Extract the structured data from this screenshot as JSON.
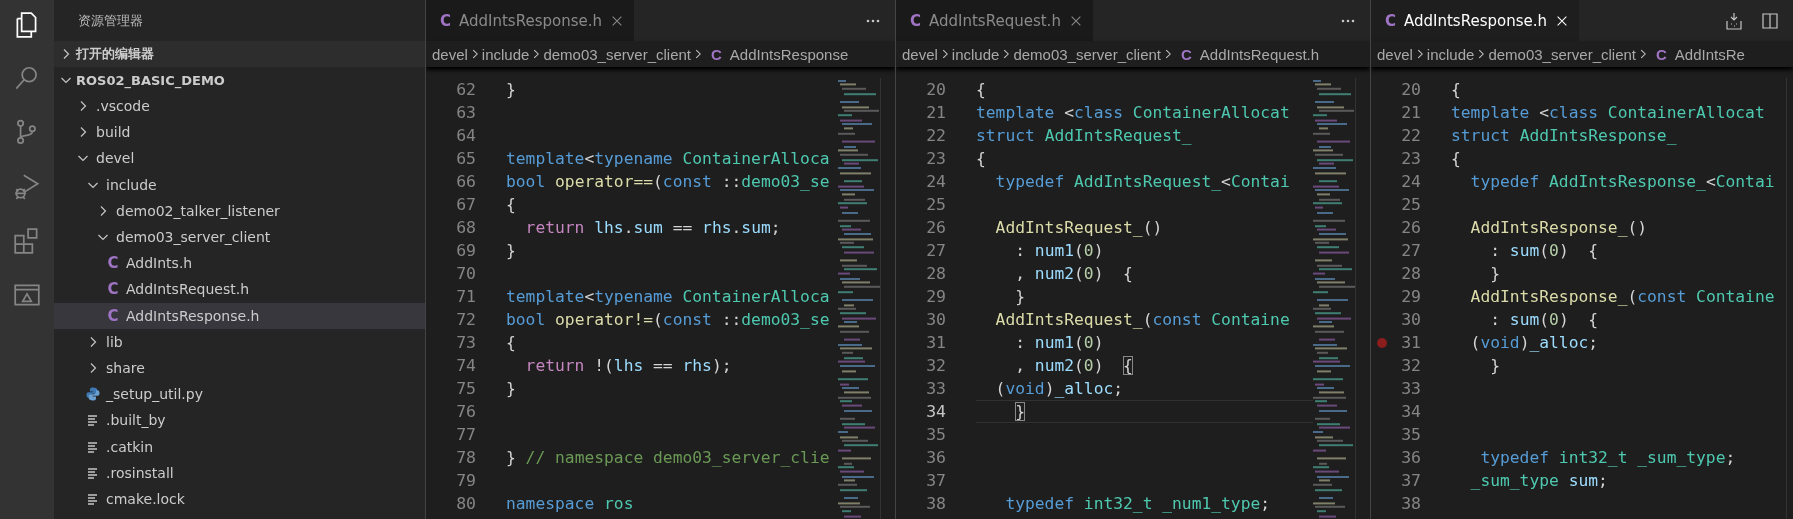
{
  "activity_bar": [
    {
      "kind": "files",
      "selected": true
    },
    {
      "kind": "search",
      "selected": false
    },
    {
      "kind": "source-control",
      "selected": false
    },
    {
      "kind": "run-debug",
      "selected": false
    },
    {
      "kind": "extensions",
      "selected": false
    },
    {
      "kind": "remote",
      "selected": false
    }
  ],
  "sidebar": {
    "title": "资源管理器",
    "sections": [
      {
        "label": "打开的编辑器",
        "expanded": false
      },
      {
        "label": "ROS02_BASIC_DEMO",
        "expanded": true,
        "items": [
          {
            "label": ".vscode",
            "kind": "folder",
            "expanded": false,
            "selected": false
          },
          {
            "label": "build",
            "kind": "folder",
            "expanded": false,
            "selected": false
          },
          {
            "label": "devel",
            "kind": "folder",
            "expanded": true,
            "selected": false,
            "children": [
              {
                "label": "include",
                "kind": "folder",
                "expanded": true,
                "selected": false,
                "children": [
                  {
                    "label": "demo02_talker_listener",
                    "kind": "folder",
                    "expanded": false,
                    "selected": false
                  },
                  {
                    "label": "demo03_server_client",
                    "kind": "folder",
                    "expanded": true,
                    "selected": false,
                    "children": [
                      {
                        "label": "AddInts.h",
                        "kind": "c",
                        "icon": "C",
                        "selected": false
                      },
                      {
                        "label": "AddIntsRequest.h",
                        "kind": "c",
                        "icon": "C",
                        "selected": false
                      },
                      {
                        "label": "AddIntsResponse.h",
                        "kind": "c",
                        "icon": "C",
                        "selected": true
                      }
                    ]
                  }
                ]
              },
              {
                "label": "lib",
                "kind": "folder",
                "expanded": false,
                "selected": false
              },
              {
                "label": "share",
                "kind": "folder",
                "expanded": false,
                "selected": false
              },
              {
                "label": "_setup_util.py",
                "kind": "python",
                "selected": false
              },
              {
                "label": ".built_by",
                "kind": "text",
                "selected": false
              },
              {
                "label": ".catkin",
                "kind": "text",
                "selected": false
              },
              {
                "label": ".rosinstall",
                "kind": "text",
                "selected": false
              },
              {
                "label": "cmake.lock",
                "kind": "text",
                "selected": false
              }
            ]
          }
        ]
      }
    ]
  },
  "editors": [
    {
      "tab": {
        "icon": "C",
        "label": "AddIntsResponse.h",
        "selected": false
      },
      "actions": [
        {
          "kind": "more"
        }
      ],
      "breadcrumb": [
        "devel",
        "include",
        "demo03_server_client"
      ],
      "breadcrumb_file": {
        "icon": "C",
        "label": "AddIntsResponse"
      },
      "minimap": true,
      "lines": [
        {
          "number": "62",
          "tokens": [
            {
              "kind": "plain",
              "text": "}"
            }
          ]
        },
        {
          "number": "63"
        },
        {
          "number": "64"
        },
        {
          "number": "65",
          "tokens": [
            {
              "kind": "kw",
              "text": "template"
            },
            {
              "kind": "plain",
              "text": "<"
            },
            {
              "kind": "kw",
              "text": "typename"
            },
            {
              "kind": "type",
              "text": " ContainerAlloca"
            }
          ]
        },
        {
          "number": "66",
          "tokens": [
            {
              "kind": "kw",
              "text": "bool"
            },
            {
              "kind": "fn",
              "text": " operator=="
            },
            {
              "kind": "plain",
              "text": "("
            },
            {
              "kind": "kw",
              "text": "const"
            },
            {
              "kind": "plain",
              "text": " ::"
            },
            {
              "kind": "type",
              "text": "demo03_se"
            }
          ]
        },
        {
          "number": "67",
          "tokens": [
            {
              "kind": "plain",
              "text": "{"
            }
          ]
        },
        {
          "number": "68",
          "tokens": [
            {
              "kind": "ctrl",
              "text": "  return"
            },
            {
              "kind": "var",
              "text": " lhs"
            },
            {
              "kind": "plain",
              "text": "."
            },
            {
              "kind": "var",
              "text": "sum"
            },
            {
              "kind": "plain",
              "text": " == "
            },
            {
              "kind": "var",
              "text": "rhs"
            },
            {
              "kind": "plain",
              "text": "."
            },
            {
              "kind": "var",
              "text": "sum"
            },
            {
              "kind": "plain",
              "text": ";"
            }
          ]
        },
        {
          "number": "69",
          "tokens": [
            {
              "kind": "plain",
              "text": "}"
            }
          ]
        },
        {
          "number": "70"
        },
        {
          "number": "71",
          "tokens": [
            {
              "kind": "kw",
              "text": "template"
            },
            {
              "kind": "plain",
              "text": "<"
            },
            {
              "kind": "kw",
              "text": "typename"
            },
            {
              "kind": "type",
              "text": " ContainerAlloca"
            }
          ]
        },
        {
          "number": "72",
          "tokens": [
            {
              "kind": "kw",
              "text": "bool"
            },
            {
              "kind": "fn",
              "text": " operator!="
            },
            {
              "kind": "plain",
              "text": "("
            },
            {
              "kind": "kw",
              "text": "const"
            },
            {
              "kind": "plain",
              "text": " ::"
            },
            {
              "kind": "type",
              "text": "demo03_se"
            }
          ]
        },
        {
          "number": "73",
          "tokens": [
            {
              "kind": "plain",
              "text": "{"
            }
          ]
        },
        {
          "number": "74",
          "tokens": [
            {
              "kind": "ctrl",
              "text": "  return"
            },
            {
              "kind": "plain",
              "text": " !("
            },
            {
              "kind": "var",
              "text": "lhs"
            },
            {
              "kind": "plain",
              "text": " == "
            },
            {
              "kind": "var",
              "text": "rhs"
            },
            {
              "kind": "plain",
              "text": ");"
            }
          ]
        },
        {
          "number": "75",
          "tokens": [
            {
              "kind": "plain",
              "text": "}"
            }
          ]
        },
        {
          "number": "76"
        },
        {
          "number": "77"
        },
        {
          "number": "78",
          "tokens": [
            {
              "kind": "plain",
              "text": "}"
            },
            {
              "kind": "cm",
              "text": " // namespace demo03_server_clie"
            }
          ]
        },
        {
          "number": "79"
        },
        {
          "number": "80",
          "tokens": [
            {
              "kind": "kw",
              "text": "namespace"
            },
            {
              "kind": "type",
              "text": " ros"
            }
          ]
        }
      ]
    },
    {
      "tab": {
        "icon": "C",
        "label": "AddIntsRequest.h",
        "selected": false
      },
      "actions": [
        {
          "kind": "more"
        }
      ],
      "breadcrumb": [
        "devel",
        "include",
        "demo03_server_client"
      ],
      "breadcrumb_file": {
        "icon": "C",
        "label": "AddIntsRequest.h"
      },
      "minimap": true,
      "lines": [
        {
          "number": "20",
          "current": false,
          "tokens": [
            {
              "kind": "plain",
              "text": "{"
            }
          ]
        },
        {
          "number": "21",
          "current": false,
          "tokens": [
            {
              "kind": "kw",
              "text": "template"
            },
            {
              "kind": "plain",
              "text": " <"
            },
            {
              "kind": "kw",
              "text": "class"
            },
            {
              "kind": "type",
              "text": " ContainerAllocat"
            }
          ]
        },
        {
          "number": "22",
          "current": false,
          "tokens": [
            {
              "kind": "kw",
              "text": "struct"
            },
            {
              "kind": "type",
              "text": " AddIntsRequest_"
            }
          ]
        },
        {
          "number": "23",
          "current": false,
          "tokens": [
            {
              "kind": "plain",
              "text": "{"
            }
          ]
        },
        {
          "number": "24",
          "current": false,
          "tokens": [
            {
              "kind": "kw",
              "text": "  typedef"
            },
            {
              "kind": "type",
              "text": " AddIntsRequest_"
            },
            {
              "kind": "plain",
              "text": "<"
            },
            {
              "kind": "type",
              "text": "Contai"
            }
          ]
        },
        {
          "number": "25",
          "current": false
        },
        {
          "number": "26",
          "current": false,
          "tokens": [
            {
              "kind": "fn",
              "text": "  AddIntsRequest_"
            },
            {
              "kind": "plain",
              "text": "()"
            }
          ]
        },
        {
          "number": "27",
          "current": false,
          "tokens": [
            {
              "kind": "plain",
              "text": "    : "
            },
            {
              "kind": "var",
              "text": "num1"
            },
            {
              "kind": "plain",
              "text": "("
            },
            {
              "kind": "num",
              "text": "0"
            },
            {
              "kind": "plain",
              "text": ")"
            }
          ]
        },
        {
          "number": "28",
          "current": false,
          "tokens": [
            {
              "kind": "plain",
              "text": "    , "
            },
            {
              "kind": "var",
              "text": "num2"
            },
            {
              "kind": "plain",
              "text": "("
            },
            {
              "kind": "num",
              "text": "0"
            },
            {
              "kind": "plain",
              "text": ")  {"
            }
          ]
        },
        {
          "number": "29",
          "current": false,
          "tokens": [
            {
              "kind": "plain",
              "text": "    }"
            }
          ]
        },
        {
          "number": "30",
          "current": false,
          "tokens": [
            {
              "kind": "fn",
              "text": "  AddIntsRequest_"
            },
            {
              "kind": "plain",
              "text": "("
            },
            {
              "kind": "kw",
              "text": "const"
            },
            {
              "kind": "type",
              "text": " Containe"
            }
          ]
        },
        {
          "number": "31",
          "current": false,
          "tokens": [
            {
              "kind": "plain",
              "text": "    : "
            },
            {
              "kind": "var",
              "text": "num1"
            },
            {
              "kind": "plain",
              "text": "("
            },
            {
              "kind": "num",
              "text": "0"
            },
            {
              "kind": "plain",
              "text": ")"
            }
          ]
        },
        {
          "number": "32",
          "current": false,
          "tokens": [
            {
              "kind": "plain",
              "text": "    , "
            },
            {
              "kind": "var",
              "text": "num2"
            },
            {
              "kind": "plain",
              "text": "("
            },
            {
              "kind": "num",
              "text": "0"
            },
            {
              "kind": "match",
              "text": ")  {"
            }
          ]
        },
        {
          "number": "33",
          "current": false,
          "tokens": [
            {
              "kind": "plain",
              "text": "  ("
            },
            {
              "kind": "kw",
              "text": "void"
            },
            {
              "kind": "plain",
              "text": ")"
            },
            {
              "kind": "var",
              "text": "_alloc"
            },
            {
              "kind": "plain",
              "text": ";"
            }
          ]
        },
        {
          "number": "34",
          "current": true,
          "tokens": [
            {
              "kind": "match",
              "text": "    }"
            }
          ]
        },
        {
          "number": "35",
          "current": false
        },
        {
          "number": "36",
          "current": false
        },
        {
          "number": "37",
          "current": false
        },
        {
          "number": "38",
          "current": false,
          "tokens": [
            {
              "kind": "kw",
              "text": "   typedef"
            },
            {
              "kind": "type",
              "text": " int32_t _num1_type"
            },
            {
              "kind": "plain",
              "text": ";"
            }
          ]
        }
      ]
    },
    {
      "tab": {
        "icon": "C",
        "label": "AddIntsResponse.h",
        "selected": true
      },
      "actions": [
        {
          "kind": "tray-arrow"
        },
        {
          "kind": "split"
        }
      ],
      "breadcrumb": [
        "devel",
        "include",
        "demo03_server_client"
      ],
      "breadcrumb_file": {
        "icon": "C",
        "label": "AddIntsRe"
      },
      "minimap": false,
      "lines": [
        {
          "number": "20",
          "breakpoint": false,
          "tokens": [
            {
              "kind": "plain",
              "text": "{"
            }
          ]
        },
        {
          "number": "21",
          "breakpoint": false,
          "tokens": [
            {
              "kind": "kw",
              "text": "template"
            },
            {
              "kind": "plain",
              "text": " <"
            },
            {
              "kind": "kw",
              "text": "class"
            },
            {
              "kind": "type",
              "text": " ContainerAllocat"
            }
          ]
        },
        {
          "number": "22",
          "breakpoint": false,
          "tokens": [
            {
              "kind": "kw",
              "text": "struct"
            },
            {
              "kind": "type",
              "text": " AddIntsResponse_"
            }
          ]
        },
        {
          "number": "23",
          "breakpoint": false,
          "tokens": [
            {
              "kind": "plain",
              "text": "{"
            }
          ]
        },
        {
          "number": "24",
          "breakpoint": false,
          "tokens": [
            {
              "kind": "kw",
              "text": "  typedef"
            },
            {
              "kind": "type",
              "text": " AddIntsResponse_"
            },
            {
              "kind": "plain",
              "text": "<"
            },
            {
              "kind": "type",
              "text": "Contai"
            }
          ]
        },
        {
          "number": "25",
          "breakpoint": false
        },
        {
          "number": "26",
          "breakpoint": false,
          "tokens": [
            {
              "kind": "fn",
              "text": "  AddIntsResponse_"
            },
            {
              "kind": "plain",
              "text": "()"
            }
          ]
        },
        {
          "number": "27",
          "breakpoint": false,
          "tokens": [
            {
              "kind": "plain",
              "text": "    : "
            },
            {
              "kind": "var",
              "text": "sum"
            },
            {
              "kind": "plain",
              "text": "("
            },
            {
              "kind": "num",
              "text": "0"
            },
            {
              "kind": "plain",
              "text": ")  {"
            }
          ]
        },
        {
          "number": "28",
          "breakpoint": false,
          "tokens": [
            {
              "kind": "plain",
              "text": "    }"
            }
          ]
        },
        {
          "number": "29",
          "breakpoint": false,
          "tokens": [
            {
              "kind": "fn",
              "text": "  AddIntsResponse_"
            },
            {
              "kind": "plain",
              "text": "("
            },
            {
              "kind": "kw",
              "text": "const"
            },
            {
              "kind": "type",
              "text": " Containe"
            }
          ]
        },
        {
          "number": "30",
          "breakpoint": false,
          "tokens": [
            {
              "kind": "plain",
              "text": "    : "
            },
            {
              "kind": "var",
              "text": "sum"
            },
            {
              "kind": "plain",
              "text": "("
            },
            {
              "kind": "num",
              "text": "0"
            },
            {
              "kind": "plain",
              "text": ")  {"
            }
          ]
        },
        {
          "number": "31",
          "breakpoint": true,
          "tokens": [
            {
              "kind": "plain",
              "text": "  ("
            },
            {
              "kind": "kw",
              "text": "void"
            },
            {
              "kind": "plain",
              "text": ")"
            },
            {
              "kind": "var",
              "text": "_alloc"
            },
            {
              "kind": "plain",
              "text": ";"
            }
          ]
        },
        {
          "number": "32",
          "breakpoint": false,
          "tokens": [
            {
              "kind": "plain",
              "text": "    }"
            }
          ]
        },
        {
          "number": "33",
          "breakpoint": false
        },
        {
          "number": "34",
          "breakpoint": false
        },
        {
          "number": "35",
          "breakpoint": false
        },
        {
          "number": "36",
          "breakpoint": false,
          "tokens": [
            {
              "kind": "kw",
              "text": "   typedef"
            },
            {
              "kind": "type",
              "text": " int32_t _sum_type"
            },
            {
              "kind": "plain",
              "text": ";"
            }
          ]
        },
        {
          "number": "37",
          "breakpoint": false,
          "tokens": [
            {
              "kind": "type",
              "text": "  _sum_type"
            },
            {
              "kind": "var",
              "text": " sum"
            },
            {
              "kind": "plain",
              "text": ";"
            }
          ]
        },
        {
          "number": "38",
          "breakpoint": false
        }
      ]
    }
  ]
}
